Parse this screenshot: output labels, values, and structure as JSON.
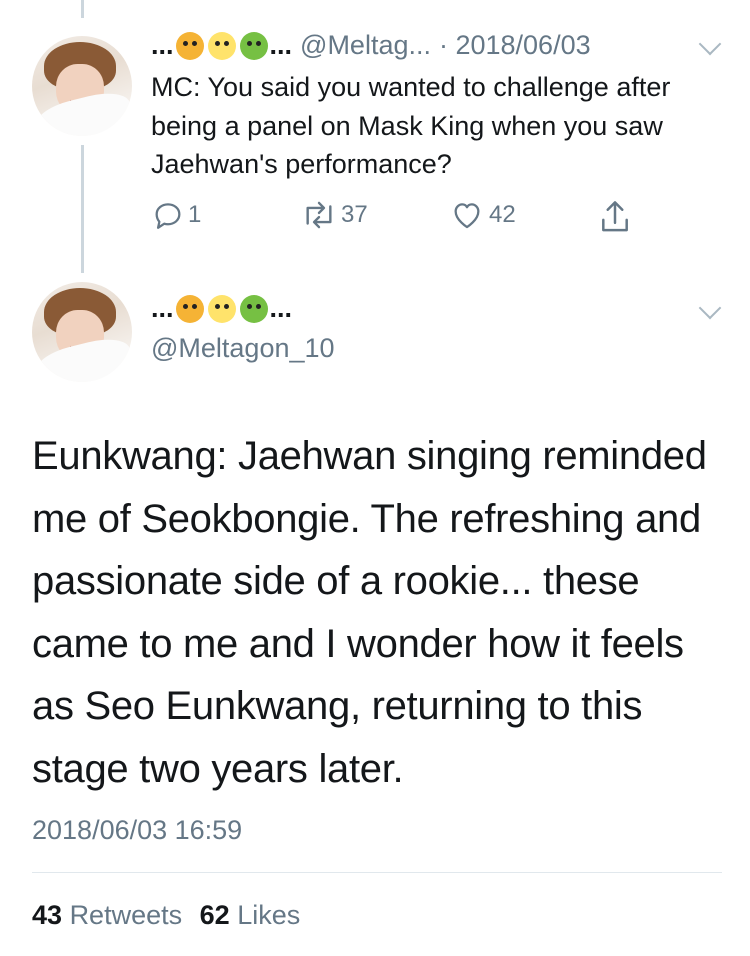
{
  "tweet1": {
    "name_prefix": "...",
    "name_suffix": "...",
    "handle": "@Meltag...",
    "date": "· 2018/06/03",
    "text": "MC: You said you wanted to challenge after being a panel on Mask King when you saw Jaehwan's performance?",
    "actions": {
      "replies": "1",
      "retweets": "37",
      "likes": "42"
    }
  },
  "tweet2": {
    "name_prefix": "...",
    "name_suffix": "...",
    "handle": "@Meltagon_10",
    "text": "Eunkwang: Jaehwan singing reminded me of Seokbongie. The refreshing and passionate side of a rookie... these came to me and I wonder how it feels as Seo Eunkwang, returning to this stage two years later.",
    "timestamp": "2018/06/03 16:59",
    "retweets_count": "43",
    "retweets_label": "Retweets",
    "likes_count": "62",
    "likes_label": "Likes"
  },
  "icons": [
    "reply-icon",
    "retweet-icon",
    "like-icon",
    "share-icon",
    "caret-down-icon"
  ],
  "colors": {
    "text": "#14171a",
    "secondary": "#657786",
    "thread_line": "#ccd6dd"
  }
}
